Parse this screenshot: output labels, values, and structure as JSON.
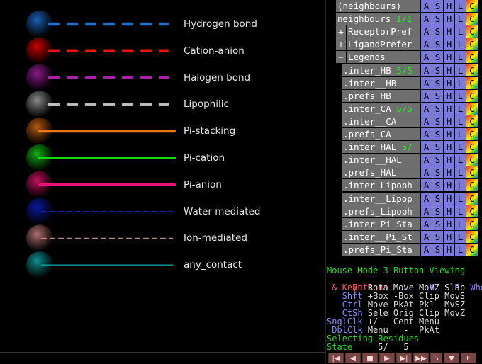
{
  "legend": [
    {
      "label": "Hydrogen bond",
      "color": "#1f6fd0",
      "ball": "#1b5fb5",
      "style": "dash"
    },
    {
      "label": "Cation-anion",
      "color": "#ee1111",
      "ball": "#cc0000",
      "style": "dash"
    },
    {
      "label": "Halogen bond",
      "color": "#aa22aa",
      "ball": "#8a1a8a",
      "style": "dash"
    },
    {
      "label": "Lipophilic",
      "color": "#bbbbbb",
      "ball": "#8a8a8a",
      "style": "dash"
    },
    {
      "label": "Pi-stacking",
      "color": "#ee7711",
      "ball": "#b55a10",
      "style": "solid"
    },
    {
      "label": "Pi-cation",
      "color": "#11dd11",
      "ball": "#10b010",
      "style": "solid"
    },
    {
      "label": "Pi-anion",
      "color": "#ee1177",
      "ball": "#c01060",
      "style": "solid"
    },
    {
      "label": "Water mediated",
      "color": "#1122aa",
      "ball": "#0a1aa0",
      "style": "thin-dash"
    },
    {
      "label": "Ion-mediated",
      "color": "#c08080",
      "ball": "#b07070",
      "style": "thin-dash"
    },
    {
      "label": "any_contact",
      "color": "#10a0a0",
      "ball": "#109090",
      "style": "thin"
    }
  ],
  "objects": [
    {
      "name": "(neighbours)",
      "state": "",
      "expander": ""
    },
    {
      "name": "neighbours",
      "state": "1/1",
      "expander": ""
    },
    {
      "name": "ReceptorPref",
      "state": "",
      "expander": "+"
    },
    {
      "name": "LigandPrefer",
      "state": "",
      "expander": "+"
    },
    {
      "name": "Legends",
      "state": "",
      "expander": "−"
    },
    {
      "name": ".inter_HB",
      "state": "5/5",
      "expander": ""
    },
    {
      "name": ".inter__HB",
      "state": "",
      "expander": ""
    },
    {
      "name": ".prefs_HB",
      "state": "",
      "expander": ""
    },
    {
      "name": ".inter_CA",
      "state": "5/5",
      "expander": ""
    },
    {
      "name": ".inter__CA",
      "state": "",
      "expander": ""
    },
    {
      "name": ".prefs_CA",
      "state": "",
      "expander": ""
    },
    {
      "name": ".inter_HAL",
      "state": "5/",
      "expander": ""
    },
    {
      "name": ".inter__HAL",
      "state": "",
      "expander": ""
    },
    {
      "name": ".prefs_HAL",
      "state": "",
      "expander": ""
    },
    {
      "name": ".inter_Lipoph",
      "state": "",
      "expander": ""
    },
    {
      "name": ".inter__Lipop",
      "state": "",
      "expander": ""
    },
    {
      "name": ".prefs_Lipoph",
      "state": "",
      "expander": ""
    },
    {
      "name": ".inter_Pi_Sta",
      "state": "",
      "expander": ""
    },
    {
      "name": ".inter__Pi_St",
      "state": "",
      "expander": ""
    },
    {
      "name": ".prefs_Pi_Sta",
      "state": "",
      "expander": ""
    }
  ],
  "buttons": {
    "a": "A",
    "s": "S",
    "h": "H",
    "l": "L",
    "c": "C"
  },
  "mouse": {
    "title": "Mouse Mode 3-Button Viewing",
    "buttons_label": " Buttons",
    "b_l": "L",
    "b_m": "M",
    "b_r": "R",
    "b_wheel": "Wheel",
    "keys_label": " & Keys",
    "keys_vals": "Rota Move MovZ Slab",
    "shft_label": "   Shft",
    "shft_vals": "+Box -Box Clip MovS",
    "ctrl_label": "   Ctrl",
    "ctrl_vals": "Move PkAt Pk1  MvSZ",
    "ctsh_label": "   CtSh",
    "ctsh_vals": "Sele Orig Clip MovZ",
    "snglclk_label": "SnglClk",
    "snglclk_vals": "+/-  Cent Menu",
    "dblclk_label": " DblClk",
    "dblclk_vals": "Menu   -  PkAt",
    "selecting": "Selecting Residues",
    "state_label": "State",
    "state_value": "5/",
    "state_total": "5"
  },
  "transport": [
    "|◀",
    "◀",
    "■",
    "▶",
    "▶|",
    "▶▶",
    "S",
    "▼",
    "F"
  ]
}
